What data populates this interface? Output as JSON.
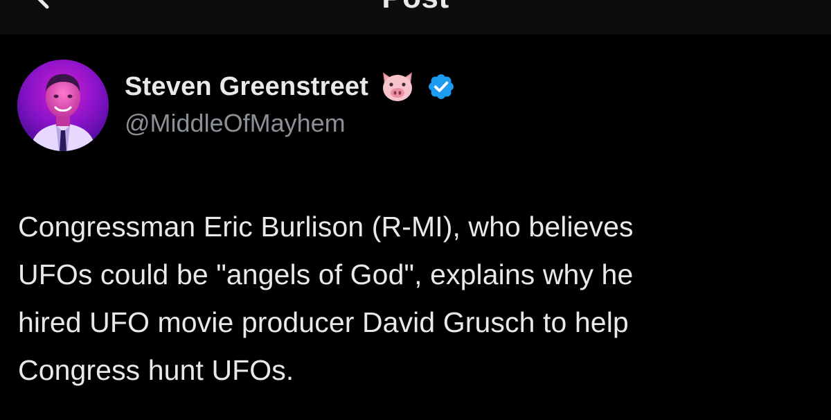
{
  "header": {
    "title": "Post",
    "back_icon": "chevron-left-icon"
  },
  "author": {
    "display_name": "Steven Greenstreet",
    "emoji_icon": "pig-face-icon",
    "verified_icon": "verified-badge-icon",
    "handle": "@MiddleOfMayhem"
  },
  "post": {
    "lines": [
      "Congressman Eric Burlison (R-MI), who believes",
      "UFOs could be \"angels of God\", explains why he",
      "hired UFO movie producer David Grusch to help",
      "Congress hunt UFOs."
    ]
  },
  "colors": {
    "background": "#000000",
    "header_background": "#0d0d0d",
    "primary_text": "#e7e9ea",
    "secondary_text": "#8b9096",
    "verified_blue": "#1d9bf0"
  }
}
